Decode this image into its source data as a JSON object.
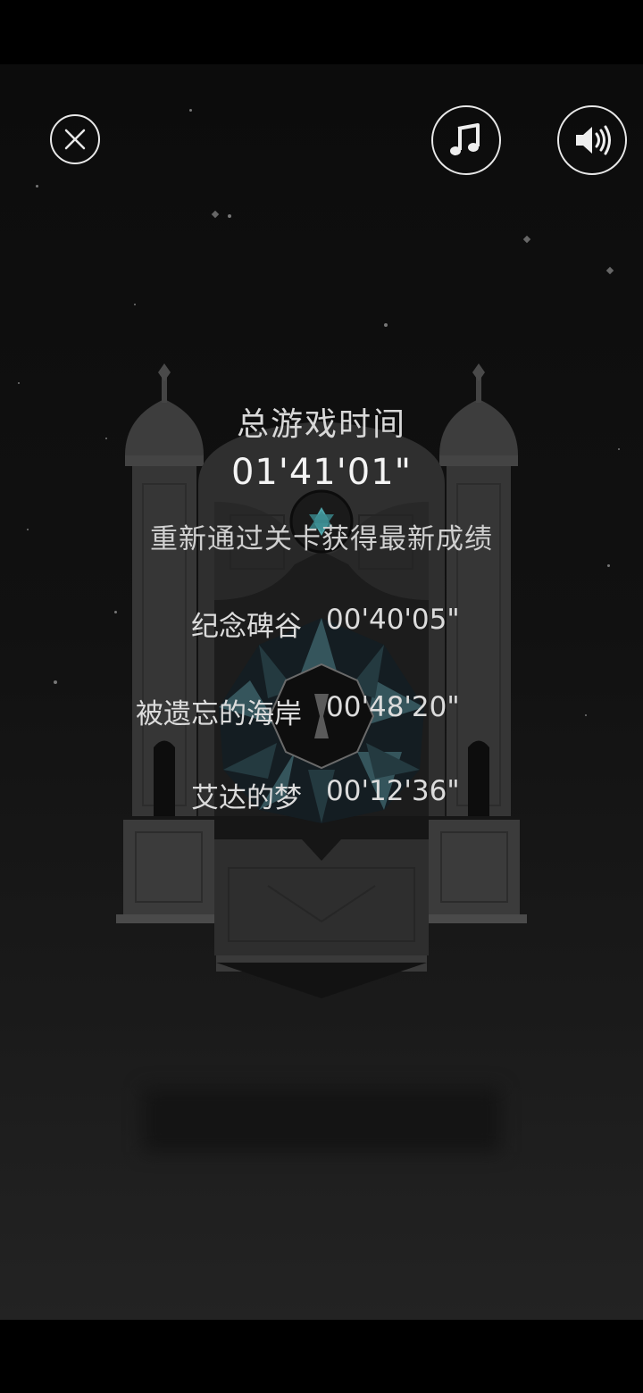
{
  "header": {
    "close_icon": "close-circle-icon",
    "music_icon": "music-note-icon",
    "sound_icon": "speaker-icon"
  },
  "summary": {
    "title": "总游戏时间",
    "total_time": "01'41'01\"",
    "hint": "重新通过关卡获得最新成绩"
  },
  "levels": [
    {
      "name": "纪念碑谷",
      "time": "00'40'05\""
    },
    {
      "name": "被遗忘的海岸",
      "time": "00'48'20\""
    },
    {
      "name": "艾达的梦",
      "time": "00'12'36\""
    }
  ],
  "colors": {
    "background": "#111111",
    "monument_stone": "#3a3a3a",
    "star_accent": "#4fa3a8",
    "text": "#dcdcdc"
  }
}
